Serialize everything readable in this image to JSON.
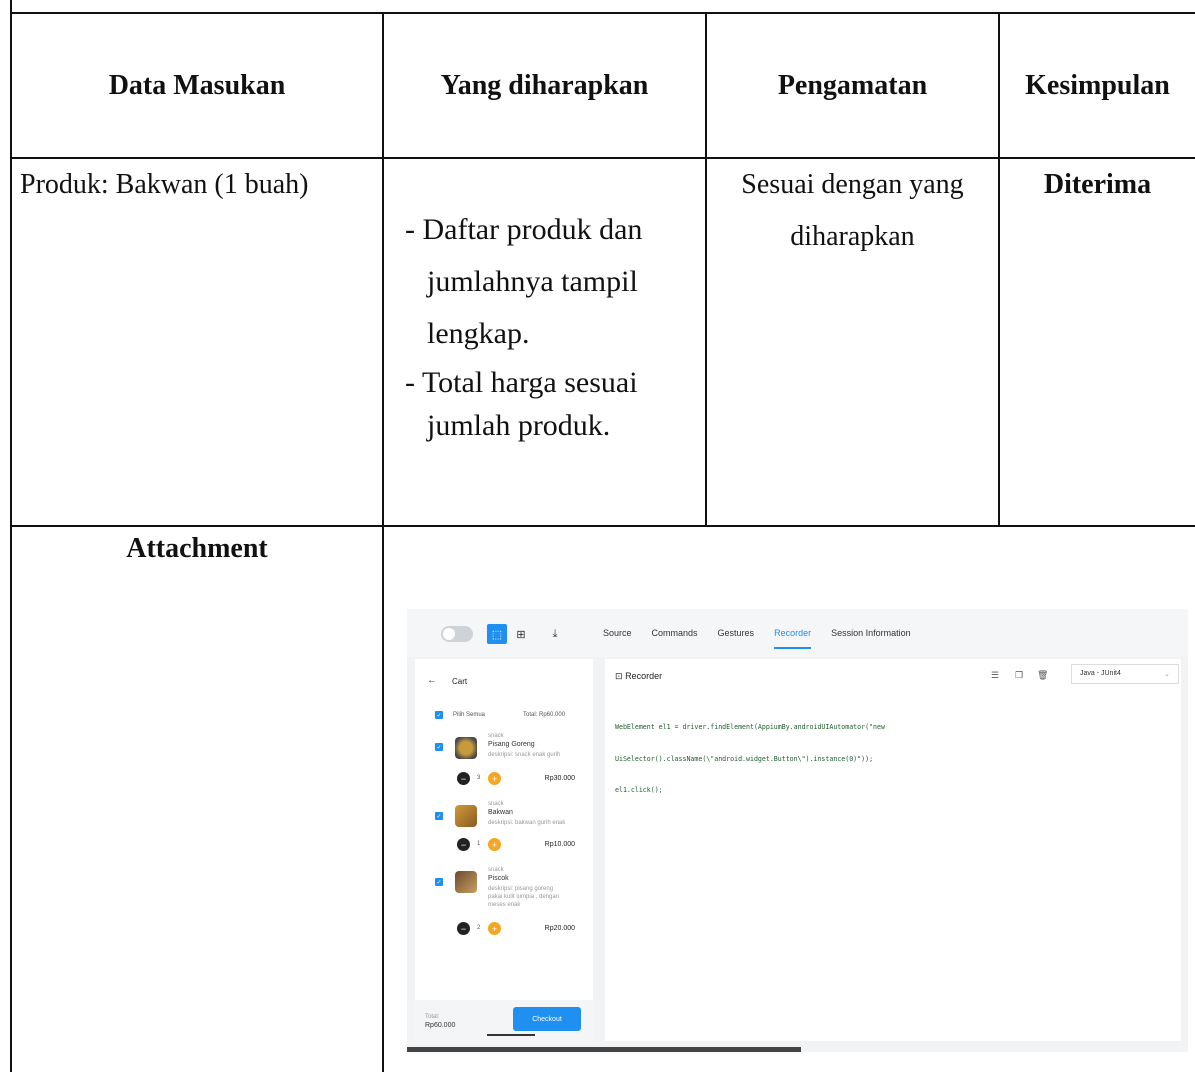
{
  "table": {
    "headers": {
      "data_masukan": "Data Masukan",
      "yang_diharapkan": "Yang diharapkan",
      "pengamatan": "Pengamatan",
      "kesimpulan": "Kesimpulan"
    },
    "row": {
      "data_masukan": "Produk: Bakwan (1 buah)",
      "expected": [
        "- Daftar produk dan",
        "jumlahnya tampil",
        "lengkap.",
        "- Total harga sesuai",
        "jumlah produk."
      ],
      "pengamatan": [
        "Sesuai dengan yang",
        "diharapkan"
      ],
      "kesimpulan": "Diterima"
    },
    "attachment_label": "Attachment"
  },
  "screenshot": {
    "tabs": [
      "Source",
      "Commands",
      "Gestures",
      "Recorder",
      "Session Information"
    ],
    "active_tab": "Recorder",
    "cart": {
      "title": "Cart",
      "select_all": "Pilih Semua",
      "total_top": "Total: Rp60.000",
      "items": [
        {
          "category": "snack",
          "name": "Pisang Goreng",
          "desc": "deskripsi: snack enak gurih",
          "qty": "3",
          "price": "Rp30.000"
        },
        {
          "category": "snack",
          "name": "Bakwan",
          "desc": "deskripsi: bakwan gurih enak",
          "qty": "1",
          "price": "Rp10.000"
        },
        {
          "category": "snack",
          "name": "Piscok",
          "desc_lines": [
            "deskripsi: pisang goreng",
            "pakai kulit lumpia , dengan",
            "meses enak"
          ],
          "qty": "2",
          "price": "Rp20.000"
        }
      ],
      "total_label": "Total:",
      "total_value": "Rp60.000",
      "checkout_label": "Checkout"
    },
    "recorder": {
      "title": "Recorder",
      "language": "Java - JUnit4",
      "code_lines": [
        "WebElement el1 = driver.findElement(AppiumBy.androidUIAutomator(\"new",
        "UiSelector().className(\\\"android.widget.Button\\\").instance(0)\"));",
        "el1.click();"
      ]
    }
  },
  "colors": {
    "accent": "#1f8ff0",
    "orange": "#f6a623"
  }
}
